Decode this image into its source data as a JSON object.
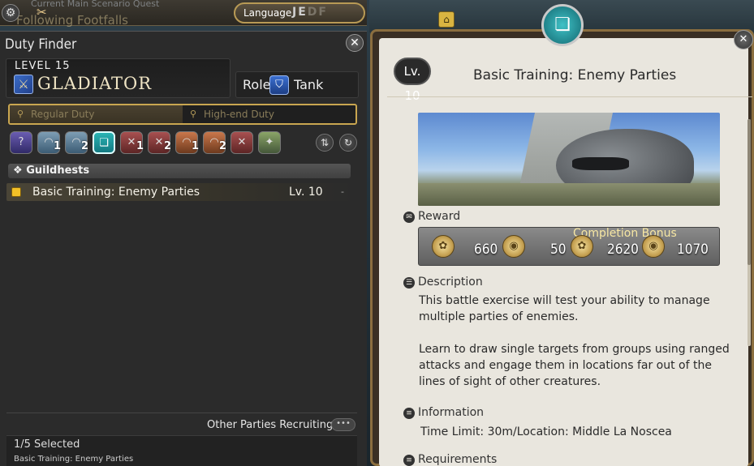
{
  "topbar": {
    "quest_line1": "Current Main Scenario Quest",
    "quest_line2": "Following Footfalls",
    "language_label": "Language",
    "language_options": [
      "J",
      "E",
      "D",
      "F"
    ]
  },
  "duty_finder": {
    "title": "Duty Finder",
    "level_label": "LEVEL 15",
    "class_name": "GLADIATOR",
    "role_label": "Role:",
    "role_name": "Tank",
    "tabs": [
      {
        "label": "Regular Duty",
        "active": true
      },
      {
        "label": "High-end Duty",
        "active": false
      }
    ],
    "duty_type_buttons": [
      {
        "icon": "question-icon",
        "num": ""
      },
      {
        "icon": "dungeon-icon",
        "num": "1"
      },
      {
        "icon": "dungeon-icon",
        "num": "2"
      },
      {
        "icon": "guildhest-icon",
        "num": ""
      },
      {
        "icon": "trial-icon",
        "num": "1"
      },
      {
        "icon": "trial-icon",
        "num": "2"
      },
      {
        "icon": "raid-icon",
        "num": "1"
      },
      {
        "icon": "raid-icon",
        "num": "2"
      },
      {
        "icon": "pvp-icon",
        "num": ""
      },
      {
        "icon": "gold-saucer-icon",
        "num": ""
      }
    ],
    "category": "Guildhests",
    "duties": [
      {
        "name": "Basic Training: Enemy Parties",
        "level": "Lv. 10",
        "minus": "-"
      }
    ],
    "other_parties_label": "Other Parties Recruiting",
    "recruit_btn": "•••",
    "selected_count": "1/5 Selected",
    "selected_item": "Basic Training: Enemy Parties"
  },
  "detail": {
    "level_badge": "Lv. 10",
    "title": "Basic Training: Enemy Parties",
    "reward_label": "Reward",
    "completion_bonus_label": "Completion Bonus",
    "rewards": [
      "660",
      "50",
      "2620",
      "1070"
    ],
    "description_label": "Description",
    "description_p1": "This battle exercise will test your ability to manage multiple parties of enemies.",
    "description_p2": "Learn to draw single targets from groups using ranged attacks and engage them in locations far out of the lines of sight of other creatures.",
    "information_label": "Information",
    "information_text": "Time Limit: 30m/Location: Middle La Noscea",
    "requirements_label": "Requirements"
  },
  "colors": {
    "accent_gold": "#c9a650",
    "parchment": "#e9e6de",
    "panel_bg": "#2b2b2b",
    "tank_blue": "#3b6fd0"
  }
}
